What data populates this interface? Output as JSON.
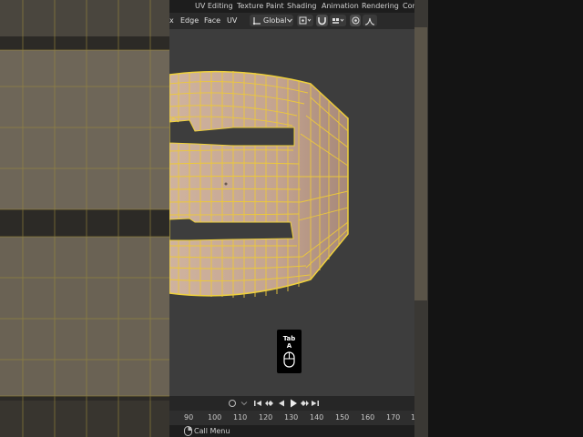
{
  "menu": {
    "items": [
      "UV Editing",
      "Texture Paint",
      "Shading",
      "Animation",
      "Rendering",
      "Com"
    ]
  },
  "header": {
    "select_modes": [
      "x",
      "Edge",
      "Face",
      "UV"
    ],
    "transform_orientation": "Global"
  },
  "key_overlay": {
    "keys": [
      "Tab",
      "A"
    ]
  },
  "timeline": {
    "frames": [
      "90",
      "100",
      "110",
      "120",
      "130",
      "140",
      "150",
      "160",
      "170",
      "1"
    ]
  },
  "status_bar": {
    "hint": "Call Menu"
  },
  "colors": {
    "wire": "#f0d23c",
    "face": "#c6a693",
    "viewport_bg": "#3d3d3d"
  }
}
